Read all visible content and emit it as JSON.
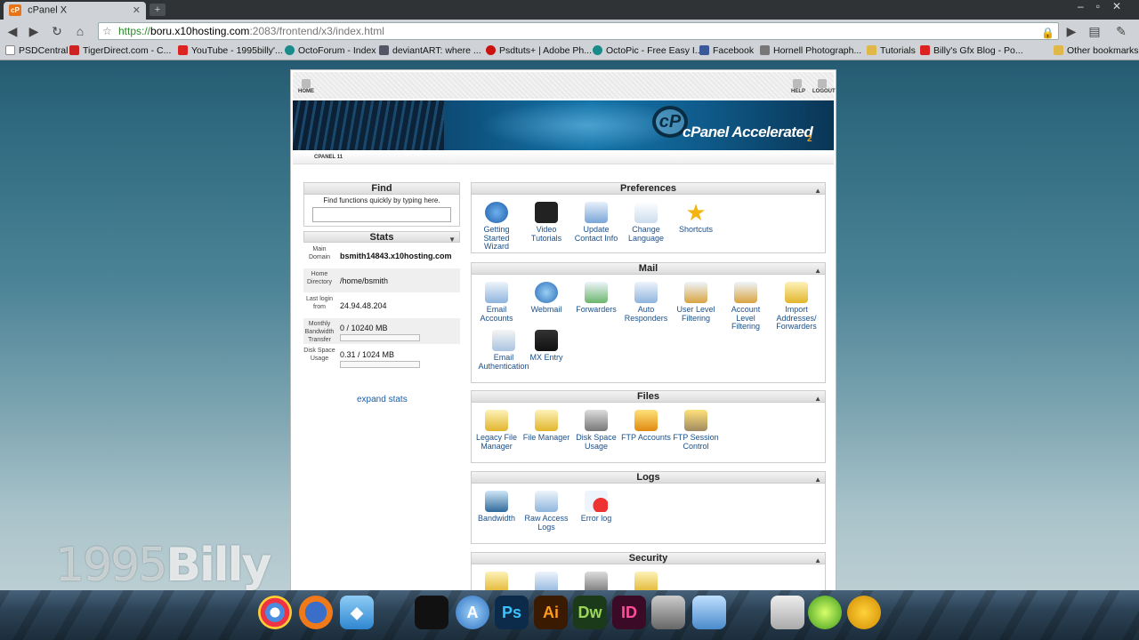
{
  "browser": {
    "tab_title": "cPanel X",
    "tab_icon": "cP",
    "url_scheme": "https://",
    "url_host": "boru.x10hosting.com",
    "url_path": ":2083/frontend/x3/index.html",
    "bookmarks": [
      "PSDCentral",
      "TigerDirect.com - C...",
      "YouTube - 1995billy'...",
      "OctoForum - Index",
      "deviantART: where ...",
      "Psdtuts+ | Adobe Ph...",
      "OctoPic - Free Easy I...",
      "Facebook",
      "Hornell Photograph...",
      "Tutorials",
      "Billy's Gfx Blog - Po...",
      "Other bookmarks"
    ]
  },
  "cpanel": {
    "home_label": "HOME",
    "help_label": "HELP",
    "logout_label": "LOGOUT",
    "brand_letters": "cP",
    "brand_title": "cPanel Accelerated",
    "brand_sub": "2",
    "crumb": "CPANEL 11",
    "find": {
      "title": "Find",
      "hint": "Find functions quickly by typing here.",
      "value": ""
    },
    "stats": {
      "title": "Stats",
      "rows": [
        {
          "label": "Main Domain",
          "value": "bsmith14843.x10hosting.com"
        },
        {
          "label": "Home Directory",
          "value": "/home/bsmith"
        },
        {
          "label": "Last login from",
          "value": "24.94.48.204"
        },
        {
          "label": "Monthly Bandwidth Transfer",
          "value": "0 / 10240 MB",
          "fill": 0.0
        },
        {
          "label": "Disk Space Usage",
          "value": "0.31 / 1024 MB",
          "fill": 0.0003
        }
      ],
      "expand": "expand stats"
    },
    "sections": {
      "preferences": {
        "title": "Preferences",
        "items": [
          "Getting Started Wizard",
          "Video Tutorials",
          "Update Contact Info",
          "Change Language",
          "Shortcuts"
        ]
      },
      "mail": {
        "title": "Mail",
        "items": [
          "Email Accounts",
          "Webmail",
          "Forwarders",
          "Auto Responders",
          "User Level Filtering",
          "Account Level Filtering",
          "Import Addresses/ Forwarders",
          "Email Authentication",
          "MX Entry"
        ]
      },
      "files": {
        "title": "Files",
        "items": [
          "Legacy File Manager",
          "File Manager",
          "Disk Space Usage",
          "FTP Accounts",
          "FTP Session Control"
        ]
      },
      "logs": {
        "title": "Logs",
        "items": [
          "Bandwidth",
          "Raw Access Logs",
          "Error log"
        ]
      },
      "security": {
        "title": "Security"
      }
    }
  },
  "watermark": {
    "a": "1995",
    "b": "Billy"
  },
  "colors": {
    "link": "#1a4f8a",
    "banner": "#0d4d78",
    "accent": "#f0a020"
  }
}
